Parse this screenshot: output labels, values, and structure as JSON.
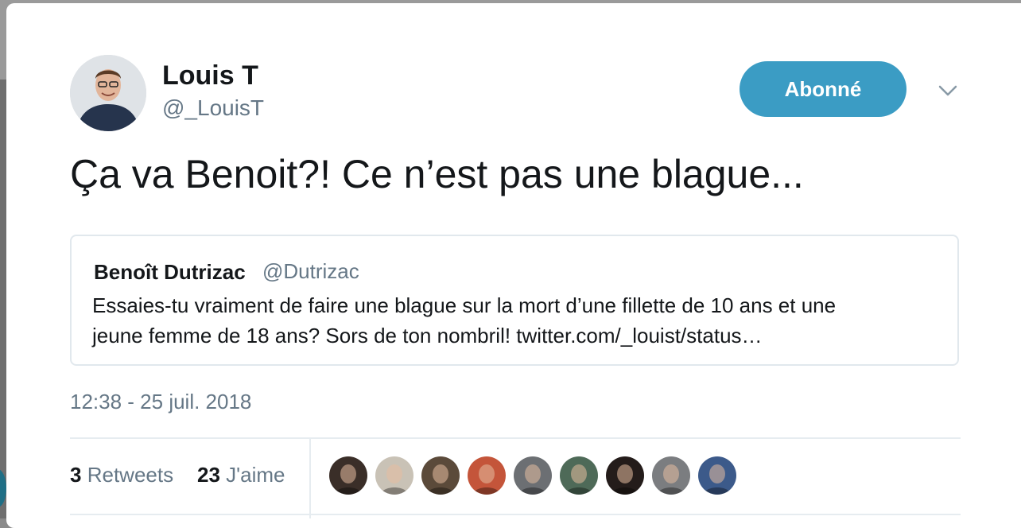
{
  "author": {
    "name": "Louis T",
    "handle": "@_LouisT"
  },
  "follow_button": {
    "label": "Abonné"
  },
  "menu": {
    "icon": "chevron-down-icon"
  },
  "tweet": {
    "text": "Ça va Benoit?! Ce n’est pas une blague..."
  },
  "quoted_tweet": {
    "name": "Benoît Dutrizac",
    "handle": "@Dutrizac",
    "text_line1": "Essaies-tu vraiment de faire une blague sur la mort d’une fillette de 10 ans et une",
    "text_line2": "jeune femme de 18 ans? Sors de ton nombril! twitter.com/_louist/status…"
  },
  "timestamp": "12:38 - 25 juil. 2018",
  "stats": {
    "retweets_count": "3",
    "retweets_label": "Retweets",
    "likes_count": "23",
    "likes_label": "J'aime"
  },
  "likers": [
    {
      "color": "#3a2e28"
    },
    {
      "color": "#c9c2b6"
    },
    {
      "color": "#5b4a3a"
    },
    {
      "color": "#c4553a"
    },
    {
      "color": "#6c6f73"
    },
    {
      "color": "#4e6a58"
    },
    {
      "color": "#241c1a"
    },
    {
      "color": "#7b7d80"
    },
    {
      "color": "#3c5a8a"
    }
  ],
  "colors": {
    "accent": "#3b9cc4",
    "text_primary": "#14171a",
    "text_secondary": "#657786",
    "border": "#e1e8ed"
  }
}
